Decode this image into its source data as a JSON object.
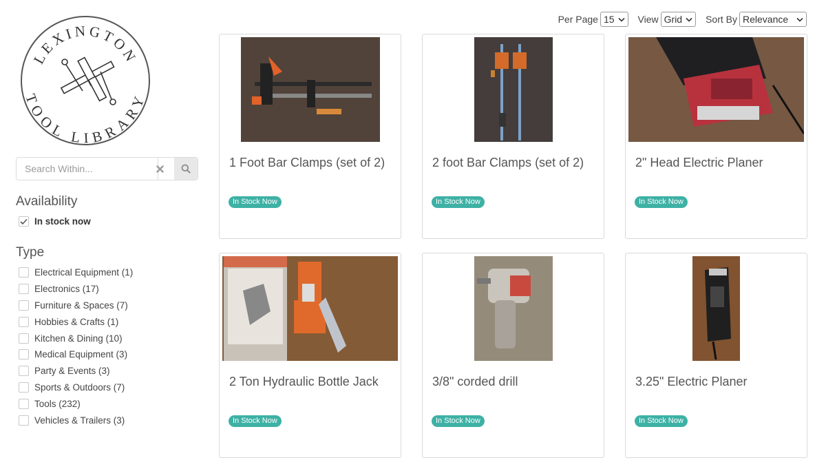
{
  "logo": {
    "top_text": "LEXINGTON",
    "bottom_text": "TOOL LIBRARY"
  },
  "search": {
    "placeholder": "Search Within...",
    "clear_icon": "close-icon",
    "submit_icon": "search-icon"
  },
  "facets": {
    "availability": {
      "title": "Availability",
      "items": [
        {
          "label": "In stock now",
          "checked": true
        }
      ]
    },
    "type": {
      "title": "Type",
      "items": [
        {
          "label": "Electrical Equipment (1)",
          "checked": false
        },
        {
          "label": "Electronics (17)",
          "checked": false
        },
        {
          "label": "Furniture & Spaces (7)",
          "checked": false
        },
        {
          "label": "Hobbies & Crafts (1)",
          "checked": false
        },
        {
          "label": "Kitchen & Dining (10)",
          "checked": false
        },
        {
          "label": "Medical Equipment (3)",
          "checked": false
        },
        {
          "label": "Party & Events (3)",
          "checked": false
        },
        {
          "label": "Sports & Outdoors (7)",
          "checked": false
        },
        {
          "label": "Tools (232)",
          "checked": false
        },
        {
          "label": "Vehicles & Trailers (3)",
          "checked": false
        }
      ]
    }
  },
  "toolbar": {
    "per_page_label": "Per Page",
    "per_page_value": "15",
    "view_label": "View",
    "view_value": "Grid",
    "sort_label": "Sort By",
    "sort_value": "Relevance"
  },
  "colors": {
    "badge": "#3eb1a5",
    "border": "#d9d9d9"
  },
  "items": [
    {
      "title": "1 Foot Bar Clamps (set of 2)",
      "badge": "In Stock Now"
    },
    {
      "title": "2 foot Bar Clamps (set of 2)",
      "badge": "In Stock Now"
    },
    {
      "title": "2\" Head Electric Planer",
      "badge": "In Stock Now"
    },
    {
      "title": "2 Ton Hydraulic Bottle Jack",
      "badge": "In Stock Now"
    },
    {
      "title": "3/8\" corded drill",
      "badge": "In Stock Now"
    },
    {
      "title": "3.25\" Electric Planer",
      "badge": "In Stock Now"
    }
  ]
}
